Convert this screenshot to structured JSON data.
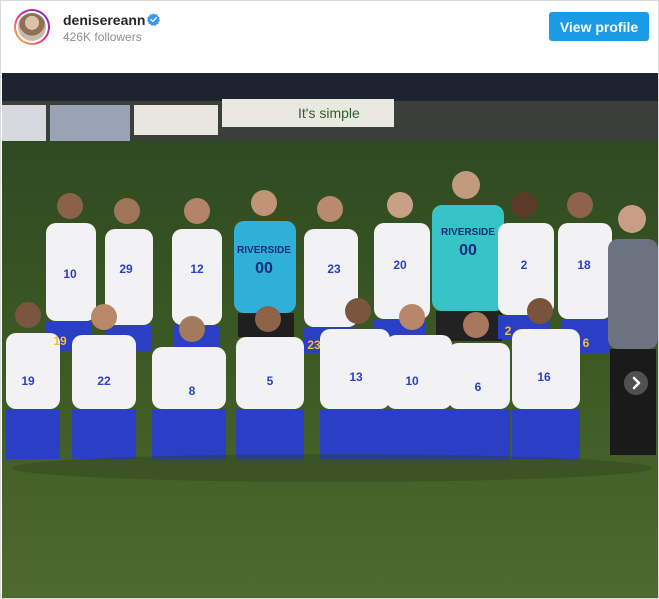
{
  "post": {
    "username": "denisereann",
    "followers": "426K followers",
    "view_profile_label": "View profile"
  },
  "photo": {
    "banner_text": "It's simple",
    "jersey_numbers": [
      "10",
      "29",
      "12",
      "00",
      "23",
      "20",
      "00",
      "2",
      "18",
      "19",
      "22",
      "8",
      "5",
      "13",
      "10",
      "6",
      "16",
      "6"
    ],
    "team_name": "RIVERSIDE",
    "shorts_numbers": [
      "19",
      "23",
      "2",
      "6"
    ]
  },
  "colors": {
    "accent": "#1a9be6",
    "verified": "#3897f0",
    "grass": "#3d5a24",
    "jersey_blue": "#2b3fc4",
    "keeper_jersey": "#2fb0d8"
  },
  "icons": {
    "verified": "verified-badge-icon",
    "next": "chevron-right-icon"
  }
}
